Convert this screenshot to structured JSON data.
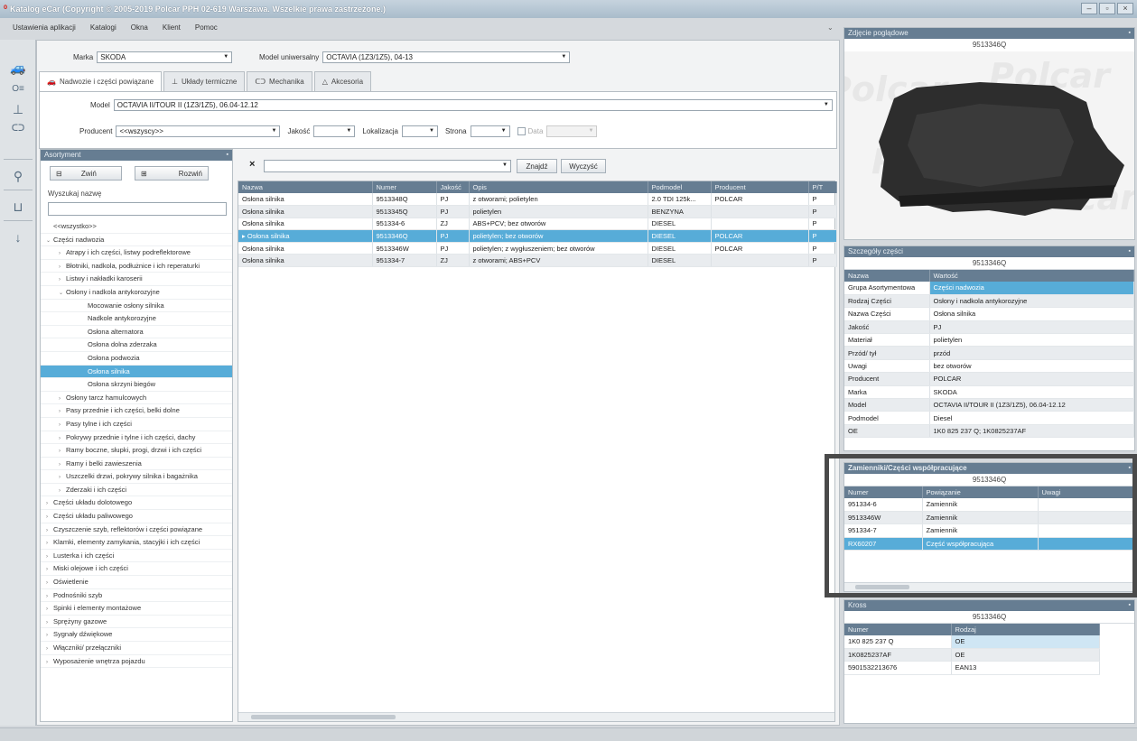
{
  "window": {
    "title": "Katalog eCar (Copyright © 2005-2019 Polcar PPH 02-619 Warszawa. Wszelkie prawa zastrzeżone.)"
  },
  "menu": [
    "Ustawienia aplikacji",
    "Katalogi",
    "Okna",
    "Klient",
    "Pomoc"
  ],
  "filters": {
    "marka_label": "Marka",
    "marka_value": "SKODA",
    "model_uni_label": "Model uniwersalny",
    "model_uni_value": "OCTAVIA (1Z3/1Z5), 04-13"
  },
  "tabs": [
    "Nadwozie i części powiązane",
    "Układy termiczne",
    "Mechanika",
    "Akcesoria"
  ],
  "subfilters": {
    "model_label": "Model",
    "model_value": "OCTAVIA II/TOUR II (1Z3/1Z5), 06.04-12.12",
    "producent_label": "Producent",
    "producent_value": "<<wszyscy>>",
    "jakosc_label": "Jakość",
    "lokalizacja_label": "Lokalizacja",
    "strona_label": "Strona",
    "data_label": "Data"
  },
  "assortment": {
    "header": "Asortyment",
    "collapse_label": "Zwiń",
    "expand_label": "Rozwiń",
    "search_label": "Wyszukaj nazwę",
    "tree": [
      {
        "label": "<<wszystko>>",
        "level": 0,
        "toggle": ""
      },
      {
        "label": "Części nadwozia",
        "level": 0,
        "toggle": "⌄"
      },
      {
        "label": "Atrapy i ich części, listwy podreflektorowe",
        "level": 1,
        "toggle": "›"
      },
      {
        "label": "Błotniki, nadkola, podłużnice i ich reperaturki",
        "level": 1,
        "toggle": "›"
      },
      {
        "label": "Listwy i nakładki karoserii",
        "level": 1,
        "toggle": "›"
      },
      {
        "label": "Osłony i nadkola antykorozyjne",
        "level": 1,
        "toggle": "⌄"
      },
      {
        "label": "Mocowanie osłony silnika",
        "level": 2,
        "toggle": ""
      },
      {
        "label": "Nadkole antykorozyjne",
        "level": 2,
        "toggle": ""
      },
      {
        "label": "Osłona alternatora",
        "level": 2,
        "toggle": ""
      },
      {
        "label": "Osłona dolna zderzaka",
        "level": 2,
        "toggle": ""
      },
      {
        "label": "Osłona podwozia",
        "level": 2,
        "toggle": ""
      },
      {
        "label": "Osłona silnika",
        "level": 2,
        "toggle": "",
        "selected": true
      },
      {
        "label": "Osłona skrzyni biegów",
        "level": 2,
        "toggle": ""
      },
      {
        "label": "Osłony tarcz hamulcowych",
        "level": 1,
        "toggle": "›"
      },
      {
        "label": "Pasy przednie i ich części, belki dolne",
        "level": 1,
        "toggle": "›"
      },
      {
        "label": "Pasy tylne i ich części",
        "level": 1,
        "toggle": "›"
      },
      {
        "label": "Pokrywy przednie i tylne i ich części, dachy",
        "level": 1,
        "toggle": "›"
      },
      {
        "label": "Ramy boczne, słupki, progi, drzwi i ich części",
        "level": 1,
        "toggle": "›"
      },
      {
        "label": "Ramy i belki zawieszenia",
        "level": 1,
        "toggle": "›"
      },
      {
        "label": "Uszczelki drzwi, pokrywy silnika i bagażnika",
        "level": 1,
        "toggle": "›"
      },
      {
        "label": "Zderzaki i ich części",
        "level": 1,
        "toggle": "›"
      },
      {
        "label": "Części układu dolotowego",
        "level": 0,
        "toggle": "›"
      },
      {
        "label": "Części układu paliwowego",
        "level": 0,
        "toggle": "›"
      },
      {
        "label": "Czyszczenie szyb, reflektorów i części powiązane",
        "level": 0,
        "toggle": "›"
      },
      {
        "label": "Klamki, elementy zamykania, stacyjki i ich części",
        "level": 0,
        "toggle": "›"
      },
      {
        "label": "Lusterka i ich części",
        "level": 0,
        "toggle": "›"
      },
      {
        "label": "Miski olejowe i ich części",
        "level": 0,
        "toggle": "›"
      },
      {
        "label": "Oświetlenie",
        "level": 0,
        "toggle": "›"
      },
      {
        "label": "Podnośniki szyb",
        "level": 0,
        "toggle": "›"
      },
      {
        "label": "Spinki i elementy montażowe",
        "level": 0,
        "toggle": "›"
      },
      {
        "label": "Sprężyny gazowe",
        "level": 0,
        "toggle": "›"
      },
      {
        "label": "Sygnały dźwiękowe",
        "level": 0,
        "toggle": "›"
      },
      {
        "label": "Włączniki/ przełączniki",
        "level": 0,
        "toggle": "›"
      },
      {
        "label": "Wyposażenie wnętrza pojazdu",
        "level": 0,
        "toggle": "›"
      }
    ]
  },
  "search": {
    "clear_glyph": "×",
    "find_label": "Znajdź",
    "clear_label": "Wyczyść"
  },
  "parts_table": {
    "columns": [
      "Nazwa",
      "Numer",
      "Jakość",
      "Opis",
      "Podmodel",
      "Producent",
      "P/T"
    ],
    "sort_indicator": "▲",
    "rows": [
      [
        "Osłona silnika",
        "9513348Q",
        "PJ",
        "z otworami; polietylen",
        "2.0 TDI 125k...",
        "POLCAR",
        "P"
      ],
      [
        "Osłona silnika",
        "9513345Q",
        "PJ",
        "polietylen",
        "BENZYNA",
        "",
        "P"
      ],
      [
        "Osłona silnika",
        "951334-6",
        "ZJ",
        "ABS+PCV;  bez otworów",
        "DIESEL",
        "",
        "P"
      ],
      [
        "Osłona silnika",
        "9513346Q",
        "PJ",
        "polietylen;  bez otworów",
        "DIESEL",
        "POLCAR",
        "P"
      ],
      [
        "Osłona silnika",
        "9513346W",
        "PJ",
        "polietylen; z wygłuszeniem;  bez otworów",
        "DIESEL",
        "POLCAR",
        "P"
      ],
      [
        "Osłona silnika",
        "951334-7",
        "ZJ",
        "z otworami; ABS+PCV",
        "DIESEL",
        "",
        "P"
      ]
    ],
    "selected_row": 3
  },
  "photo_panel": {
    "header": "Zdjęcie poglądowe",
    "code": "9513346Q"
  },
  "details_panel": {
    "header": "Szczegóły części",
    "code": "9513346Q",
    "columns": [
      "Nazwa",
      "Wartość"
    ],
    "rows": [
      [
        "Grupa Asortymentowa",
        "Części nadwozia"
      ],
      [
        "Rodzaj Części",
        "Osłony i nadkola antykorozyjne"
      ],
      [
        "Nazwa Części",
        "Osłona silnika"
      ],
      [
        "Jakość",
        "PJ"
      ],
      [
        "Materiał",
        "polietylen"
      ],
      [
        "Przód/ tył",
        "przód"
      ],
      [
        "Uwagi",
        "bez otworów"
      ],
      [
        "Producent",
        "POLCAR"
      ],
      [
        "Marka",
        "SKODA"
      ],
      [
        "Model",
        "OCTAVIA II/TOUR II (1Z3/1Z5), 06.04-12.12"
      ],
      [
        "Podmodel",
        "Diesel"
      ],
      [
        "OE",
        "1K0 825 237 Q; 1K0825237AF"
      ]
    ]
  },
  "replacements_panel": {
    "header": "Zamienniki/Części współpracujące",
    "code": "9513346Q",
    "columns": [
      "Numer",
      "Powiązanie",
      "Uwagi"
    ],
    "rows": [
      [
        "951334-6",
        "Zamiennik",
        ""
      ],
      [
        "9513346W",
        "Zamiennik",
        ""
      ],
      [
        "951334-7",
        "Zamiennik",
        ""
      ],
      [
        "RX60207",
        "Część współpracująca",
        ""
      ]
    ]
  },
  "cross_panel": {
    "header": "Kross",
    "code": "9513346Q",
    "columns": [
      "Numer",
      "Rodzaj"
    ],
    "rows": [
      [
        "1K0 825 237 Q",
        "OE"
      ],
      [
        "1K0825237AF",
        "OE"
      ],
      [
        "5901532213676",
        "EAN13"
      ]
    ]
  },
  "photo_watermark": "Polcar",
  "colors": {
    "header": "#667d92",
    "selection": "#57acd8",
    "accent_red": "#d9271c"
  }
}
